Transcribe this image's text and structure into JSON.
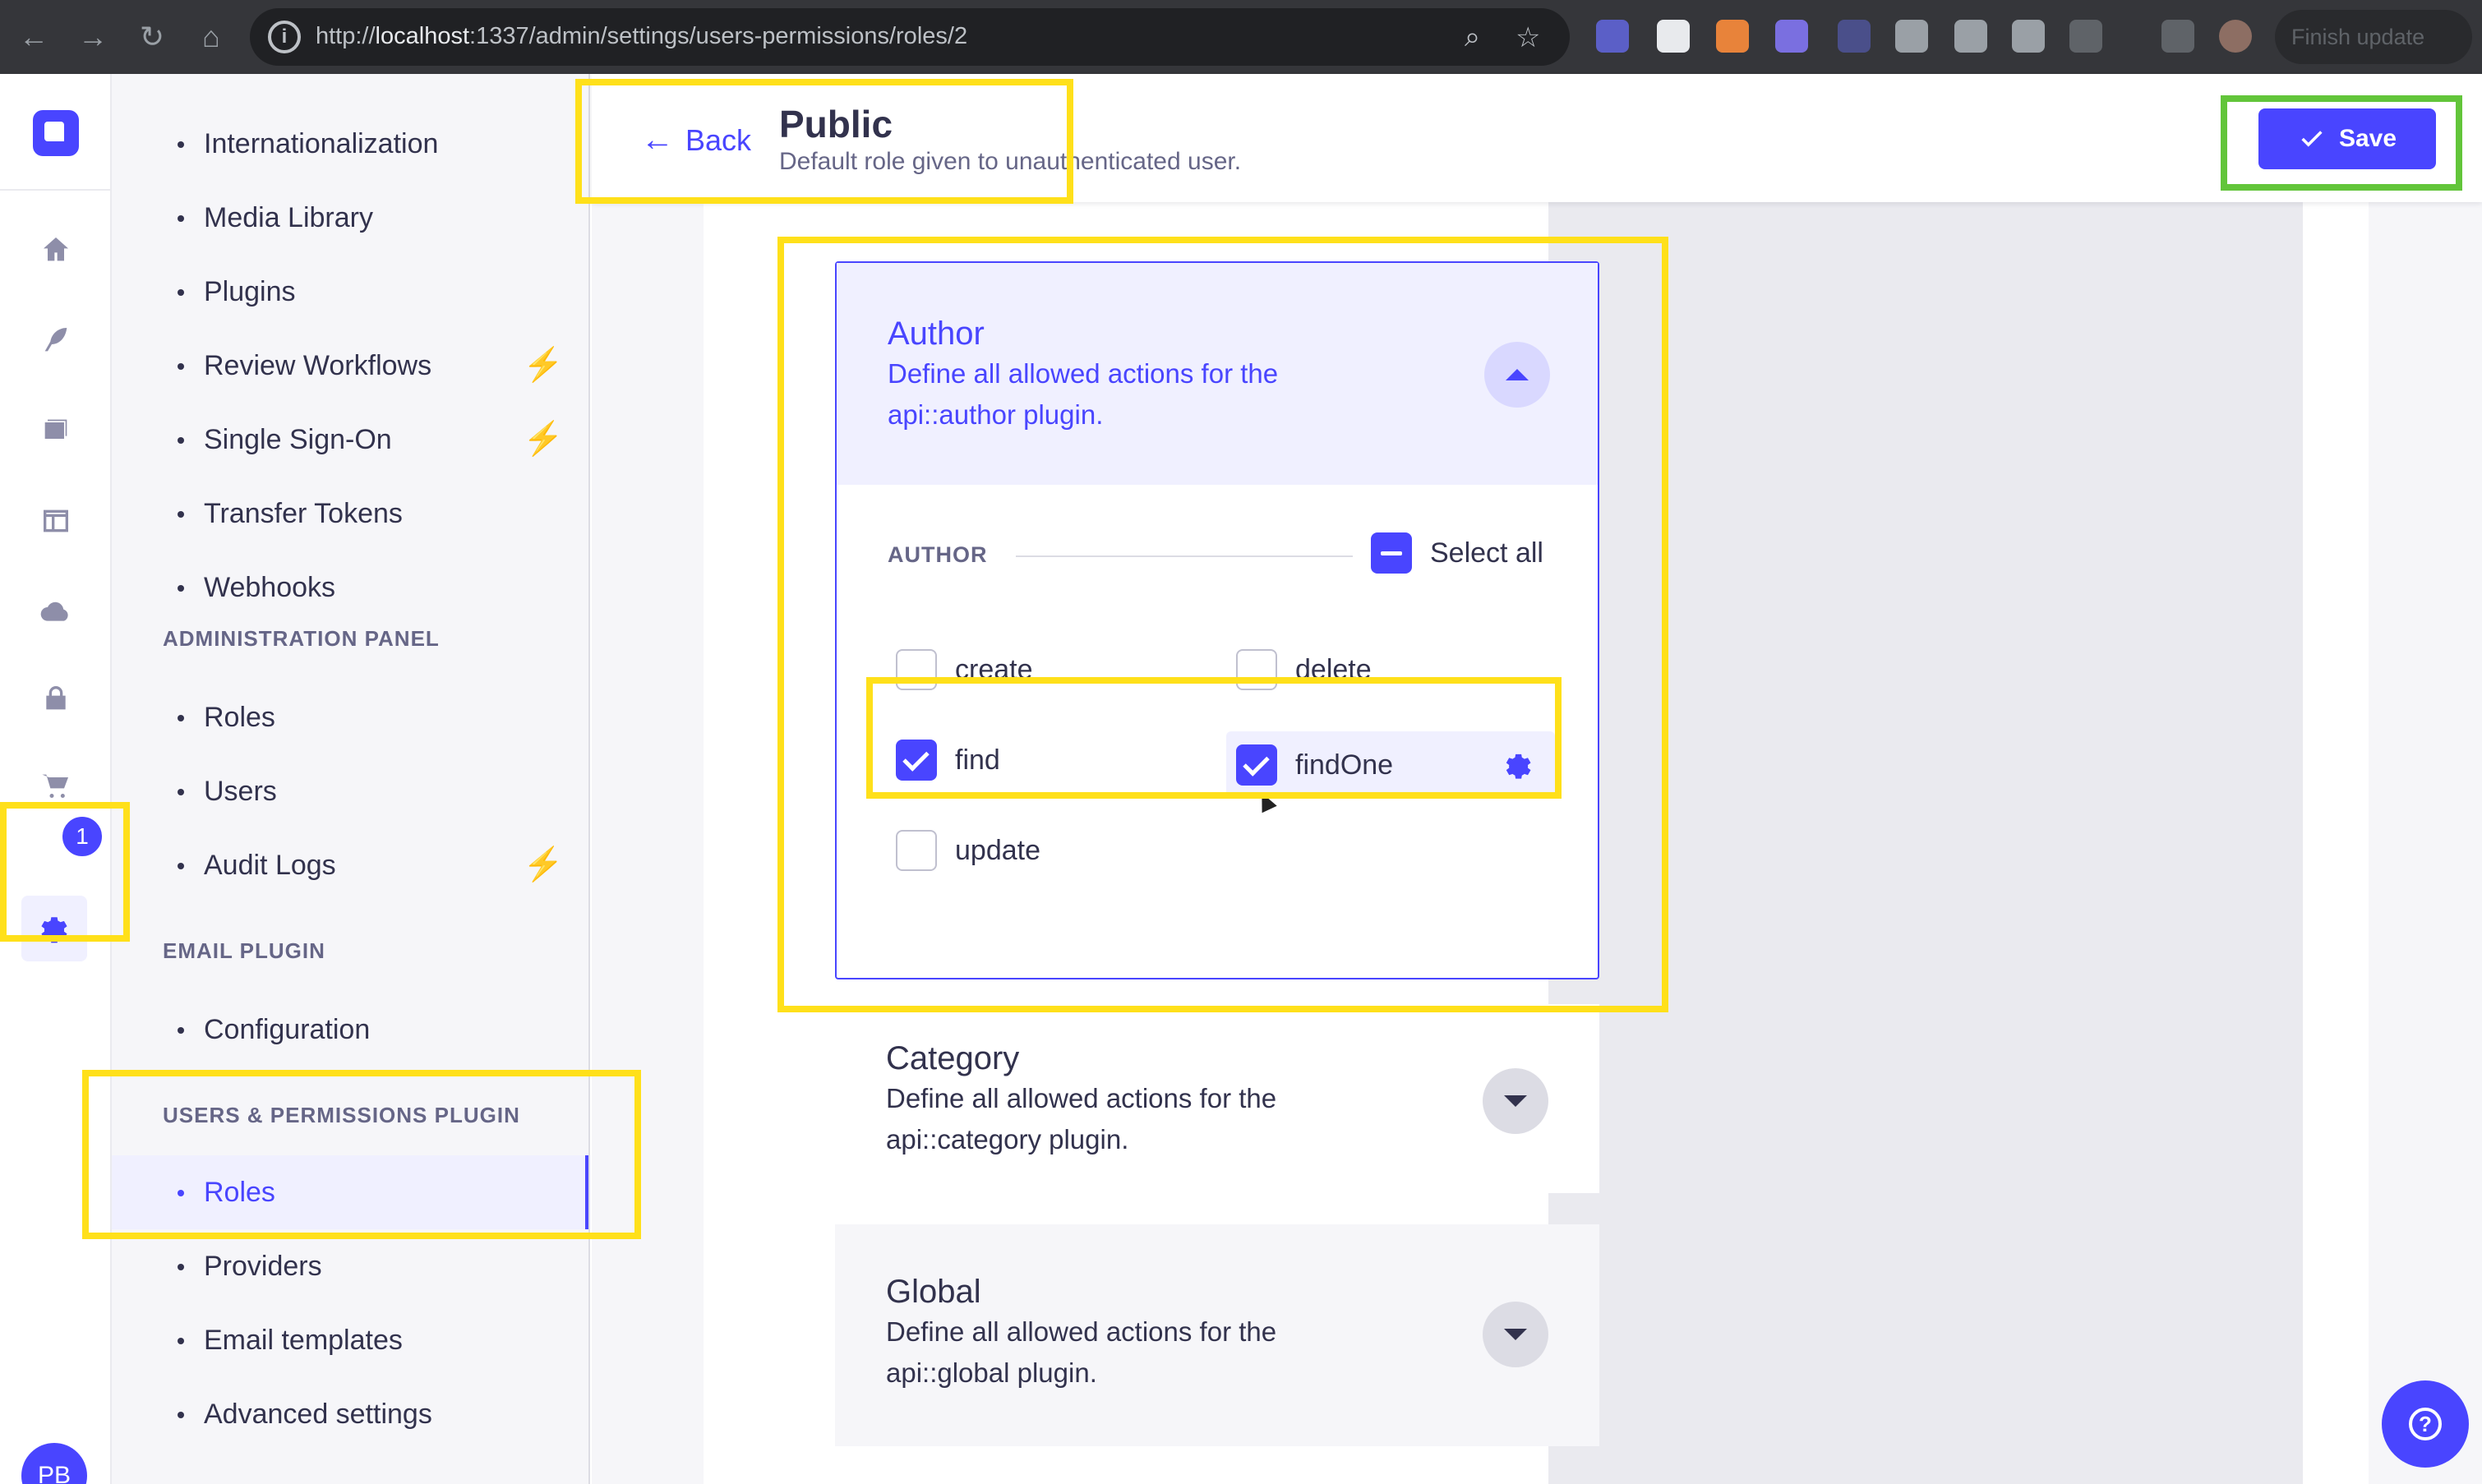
{
  "browser": {
    "url_prefix": "http://",
    "url_host": "localhost",
    "url_rest": ":1337/admin/settings/users-permissions/roles/2",
    "finish_update": "Finish update"
  },
  "rail": {
    "badge_count": "1",
    "avatar_initials": "PB"
  },
  "sidebar": {
    "items_global": [
      {
        "label": "Internationalization",
        "bolt": false
      },
      {
        "label": "Media Library",
        "bolt": false
      },
      {
        "label": "Plugins",
        "bolt": false
      },
      {
        "label": "Review Workflows",
        "bolt": true
      },
      {
        "label": "Single Sign-On",
        "bolt": true
      },
      {
        "label": "Transfer Tokens",
        "bolt": false
      },
      {
        "label": "Webhooks",
        "bolt": false
      }
    ],
    "section_admin": "ADMINISTRATION PANEL",
    "items_admin": [
      {
        "label": "Roles"
      },
      {
        "label": "Users"
      },
      {
        "label": "Audit Logs"
      }
    ],
    "section_email": "EMAIL PLUGIN",
    "items_email": [
      {
        "label": "Configuration"
      }
    ],
    "section_up": "USERS & PERMISSIONS PLUGIN",
    "items_up": [
      {
        "label": "Roles",
        "active": true
      },
      {
        "label": "Providers"
      },
      {
        "label": "Email templates"
      },
      {
        "label": "Advanced settings"
      }
    ]
  },
  "header": {
    "back_label": "Back",
    "title": "Public",
    "subtitle": "Default role given to unauthenticated user.",
    "save_label": "Save"
  },
  "accordions": {
    "author": {
      "title": "Author",
      "description": "Define all allowed actions for the api::author plugin.",
      "group_label": "AUTHOR",
      "select_all": "Select all",
      "permissions": [
        {
          "label": "create",
          "checked": false
        },
        {
          "label": "delete",
          "checked": false
        },
        {
          "label": "find",
          "checked": true
        },
        {
          "label": "findOne",
          "checked": true
        },
        {
          "label": "update",
          "checked": false
        }
      ]
    },
    "category": {
      "title": "Category",
      "description": "Define all allowed actions for the api::category plugin."
    },
    "global": {
      "title": "Global",
      "description": "Define all allowed actions for the api::global plugin."
    }
  },
  "colors": {
    "primary": "#4945ff",
    "highlight_yellow": "#ffe01a",
    "highlight_green": "#62c53a",
    "bolt": "#f29d41"
  }
}
